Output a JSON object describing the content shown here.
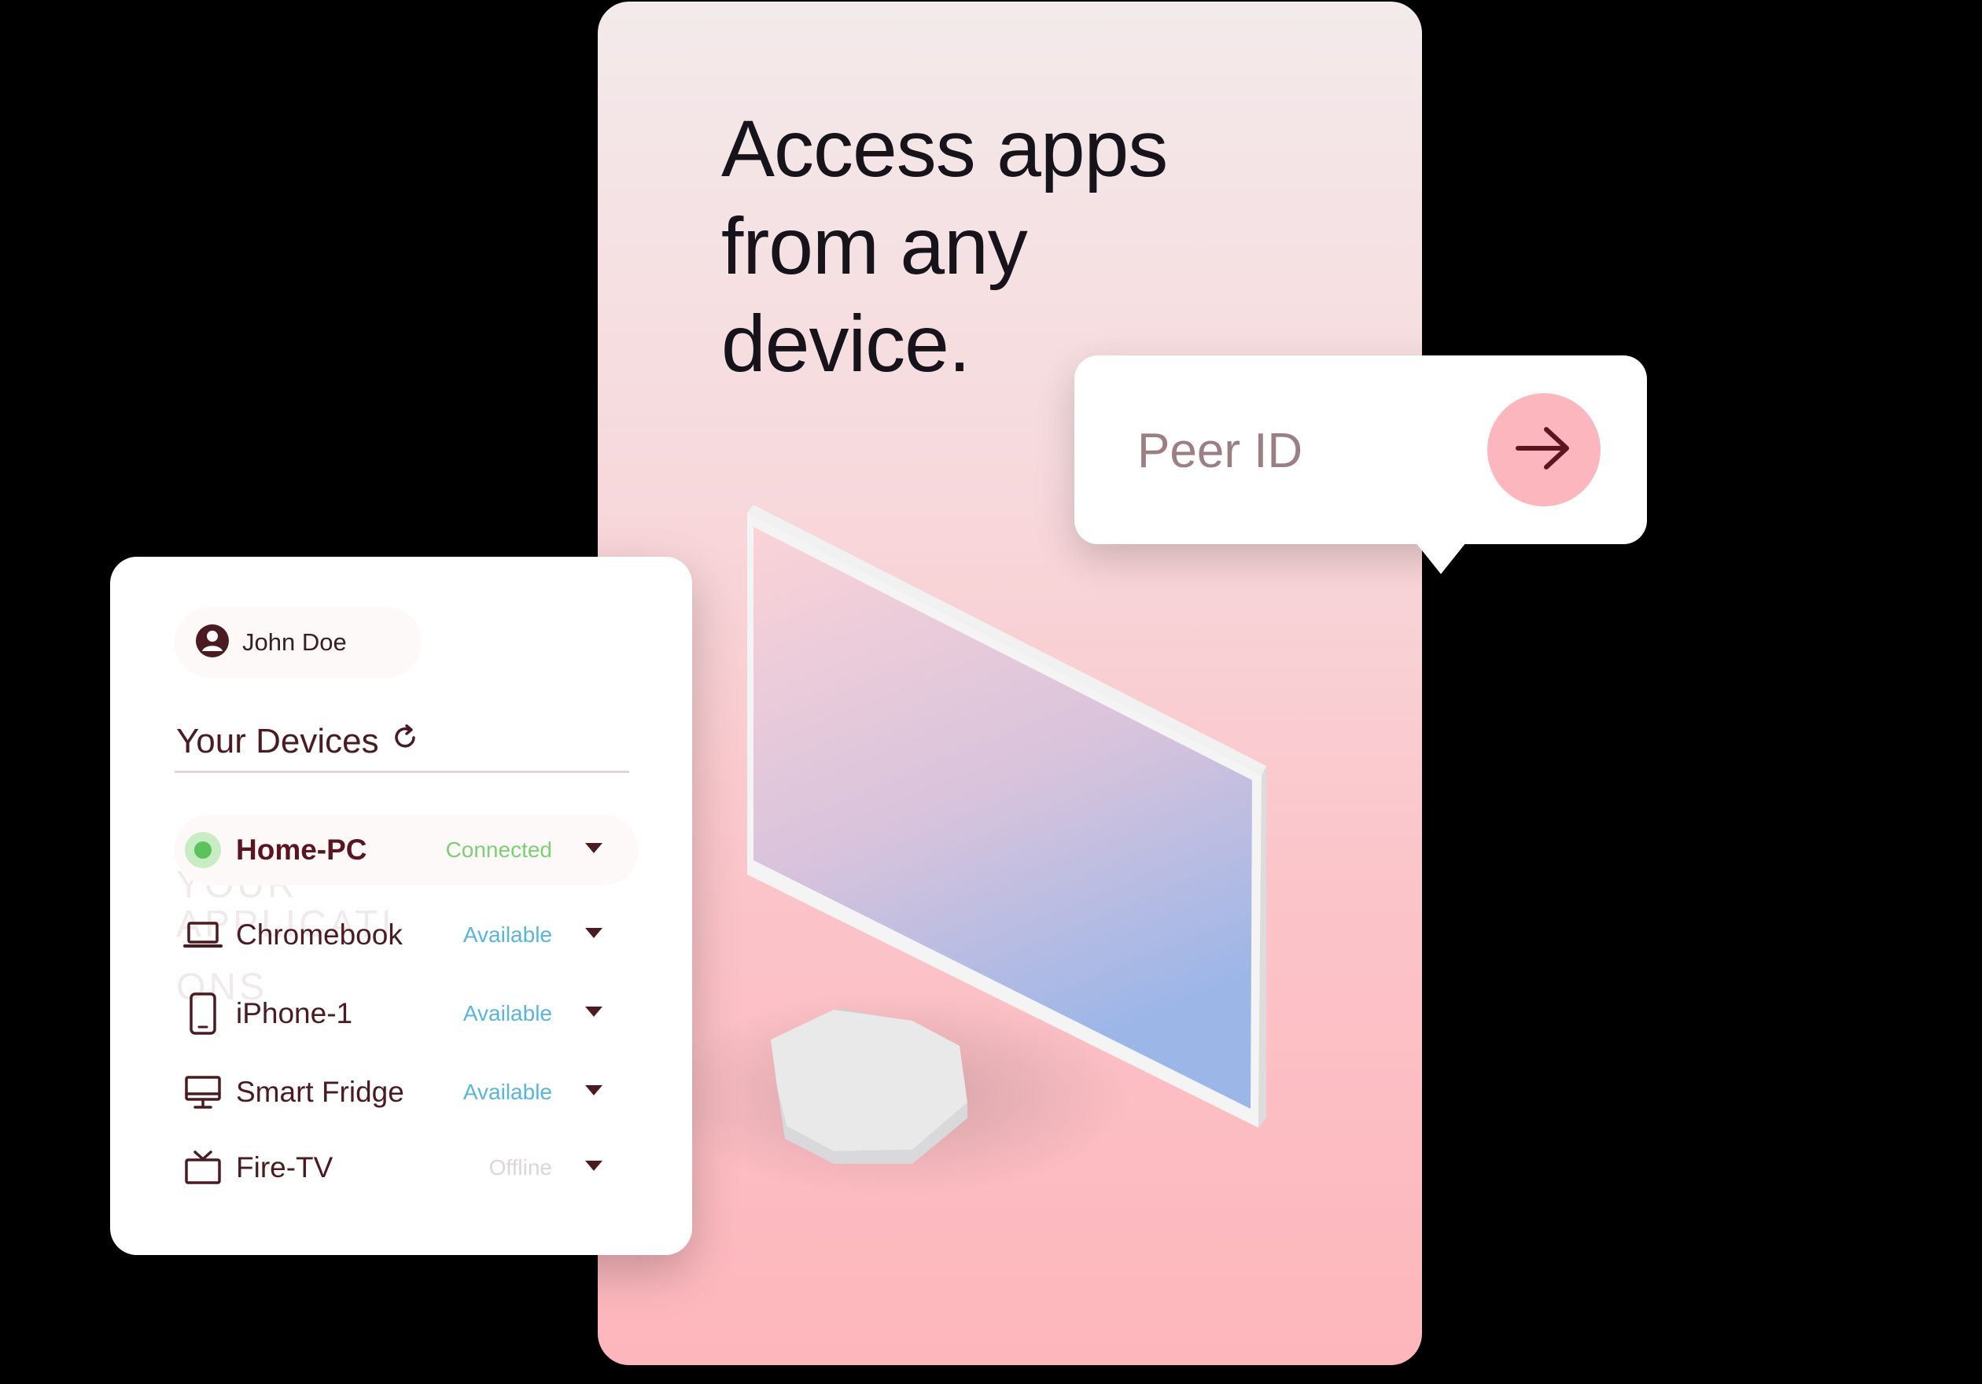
{
  "hero": {
    "headline": "Access apps from any device."
  },
  "peer": {
    "placeholder": "Peer ID",
    "submit_icon": "arrow-right-icon"
  },
  "devices_panel": {
    "user_name": "John Doe",
    "title": "Your Devices",
    "ghost_text": [
      "YOUR",
      "APPLICATI",
      "ONS"
    ],
    "devices": [
      {
        "name": "Home-PC",
        "status": "Connected",
        "icon": "status-dot-icon"
      },
      {
        "name": "Chromebook",
        "status": "Available",
        "icon": "laptop-icon"
      },
      {
        "name": "iPhone-1",
        "status": "Available",
        "icon": "phone-icon"
      },
      {
        "name": "Smart Fridge",
        "status": "Available",
        "icon": "desktop-icon"
      },
      {
        "name": "Fire-TV",
        "status": "Offline",
        "icon": "tv-icon"
      }
    ]
  },
  "colors": {
    "accent_pink": "#fcb6bd",
    "text_dark": "#4b1b22",
    "connected": "#7ccf73",
    "available": "#58b6dc",
    "offline": "#dcd6d7"
  }
}
